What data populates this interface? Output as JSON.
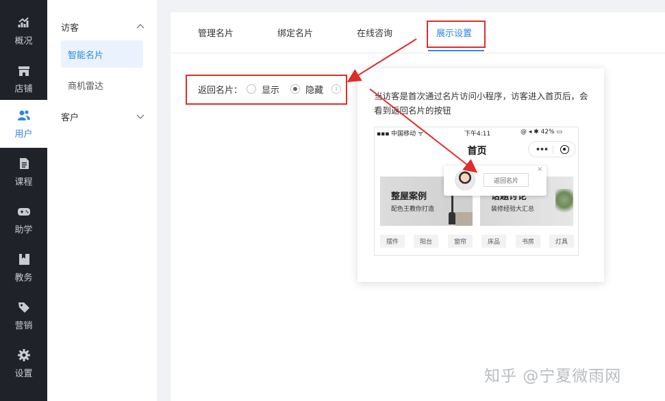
{
  "rail": {
    "items": [
      {
        "label": "概况",
        "icon": "chart-icon"
      },
      {
        "label": "店铺",
        "icon": "store-icon"
      },
      {
        "label": "用户",
        "icon": "users-icon",
        "active": true
      },
      {
        "label": "课程",
        "icon": "document-icon"
      },
      {
        "label": "助学",
        "icon": "gamepad-icon"
      },
      {
        "label": "教务",
        "icon": "bookmark-icon"
      },
      {
        "label": "营销",
        "icon": "tag-icon"
      },
      {
        "label": "设置",
        "icon": "gear-icon"
      }
    ]
  },
  "subnav": {
    "groups": [
      {
        "label": "访客",
        "expanded": true,
        "items": [
          {
            "label": "智能名片",
            "active": true
          },
          {
            "label": "商机雷达"
          }
        ]
      },
      {
        "label": "客户",
        "expanded": false,
        "items": []
      }
    ]
  },
  "tabs": [
    {
      "label": "管理名片"
    },
    {
      "label": "绑定名片"
    },
    {
      "label": "在线咨询"
    },
    {
      "label": "展示设置",
      "active": true
    }
  ],
  "setting": {
    "label": "返回名片：",
    "options": [
      {
        "label": "显示",
        "checked": false
      },
      {
        "label": "隐藏",
        "checked": true
      }
    ],
    "info": "i"
  },
  "popover": {
    "text": "当访客是首次通过名片访问小程序，访客进入首页后，会看到返回名片的按钮",
    "phone": {
      "carrier": "▪▪▪ 中国移动 ᯤ",
      "time": "下午4:11",
      "status_right": "@ ◂ ✱ 42% ▭",
      "title": "首页",
      "capsule_dots": "•••",
      "banner_a": {
        "title": "整屋案例",
        "subtitle": "配色王教你打造"
      },
      "banner_b": {
        "title": "话题讨论",
        "subtitle": "装修经验大汇总"
      },
      "tags": [
        "摆件",
        "阳台",
        "窗帘",
        "床品",
        "书房",
        "灯具"
      ],
      "float": {
        "button": "返回名片",
        "close": "×"
      }
    }
  },
  "watermark": "知乎 @宁夏微雨网",
  "colors": {
    "accent": "#2d86e6",
    "annotation_red": "#e02b2b",
    "rail_bg": "#1f2229"
  }
}
